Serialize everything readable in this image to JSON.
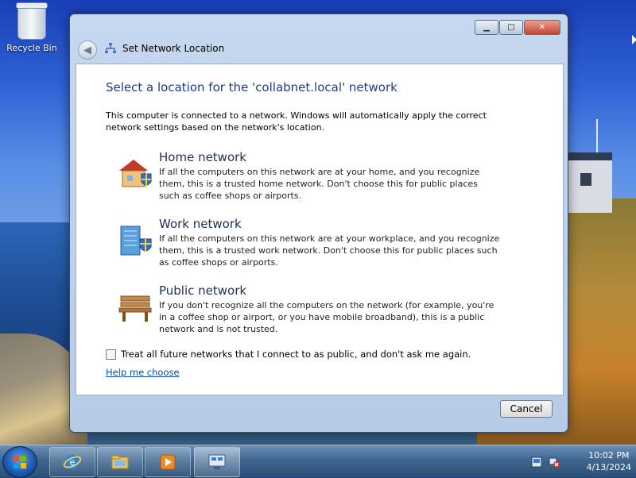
{
  "desktop": {
    "recycle_bin_label": "Recycle Bin"
  },
  "window": {
    "title": "Set Network Location",
    "controls": {
      "minimize": "minimize",
      "maximize": "maximize",
      "close": "close"
    },
    "heading": "Select a location for the 'collabnet.local' network",
    "intro": "This computer is connected to a network. Windows will automatically apply the correct network settings based on the network's location.",
    "options": [
      {
        "title": "Home network",
        "description": "If all the computers on this network are at your home, and you recognize them, this is a trusted home network.  Don't choose this for public places such as coffee shops or airports.",
        "icon": "home-network-icon"
      },
      {
        "title": "Work network",
        "description": "If all the computers on this network are at your workplace, and you recognize them, this is a trusted work network.  Don't choose this for public places such as coffee shops or airports.",
        "icon": "work-network-icon"
      },
      {
        "title": "Public network",
        "description": "If you don't recognize all the computers on the network (for example, you're in a coffee shop or airport, or you have mobile broadband), this is a public network and is not trusted.",
        "icon": "public-network-icon"
      }
    ],
    "checkbox_label": "Treat all future networks that I connect to as public, and don't ask me again.",
    "checkbox_checked": false,
    "help_link": "Help me choose",
    "cancel_label": "Cancel"
  },
  "taskbar": {
    "items": [
      "start-button",
      "internet-explorer",
      "windows-explorer",
      "media-player",
      "network-location"
    ],
    "clock_time": "10:02 PM",
    "clock_date": "4/13/2024"
  },
  "colors": {
    "heading": "#1e3a8a",
    "link": "#0c4aa6",
    "close_button": "#c3462f"
  }
}
